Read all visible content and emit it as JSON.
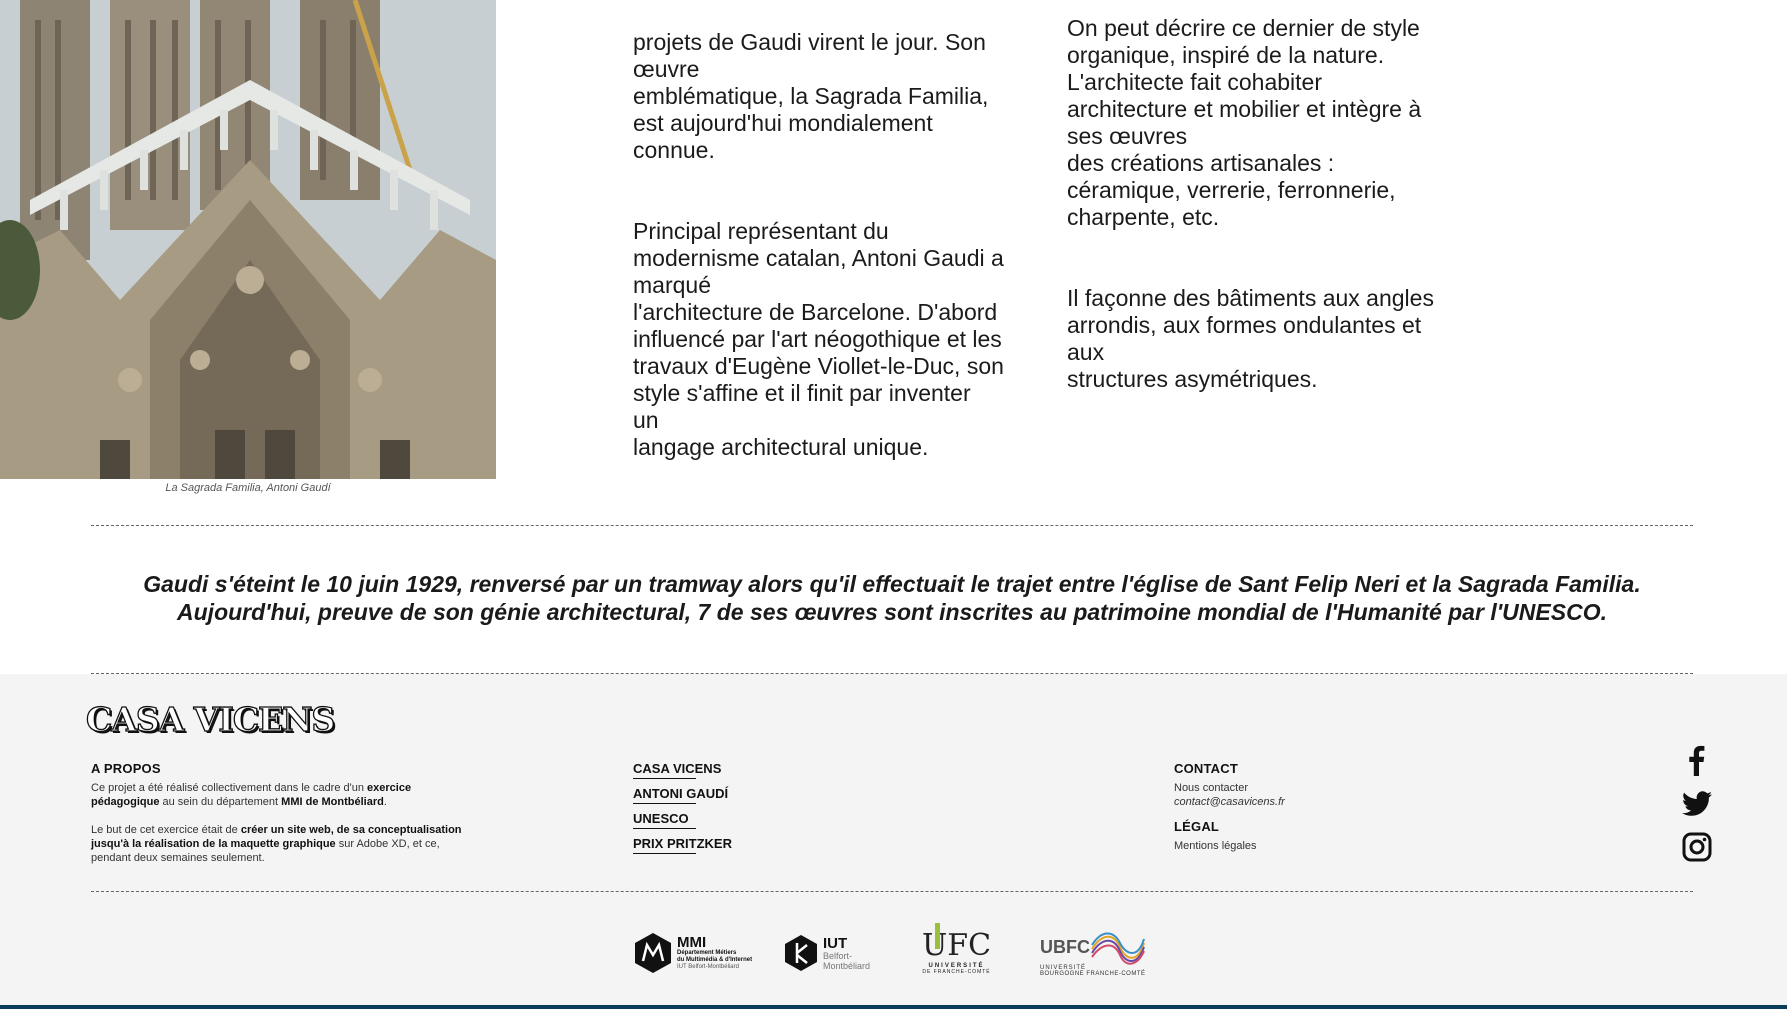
{
  "photo": {
    "alt": "La Sagrada Familia, Antoni Gaudí",
    "caption": "La Sagrada Familia, Antoni Gaudí"
  },
  "column1": {
    "p1": "projets de Gaudi virent le jour. Son\nœuvre\nemblématique, la Sagrada Familia,\nest aujourd'hui mondialement\nconnue.",
    "p2": "Principal représentant du\nmodernisme catalan, Antoni Gaudi a\nmarqué\nl'architecture de Barcelone. D'abord\ninfluencé par l'art néogothique et les\ntravaux d'Eugène Viollet-le-Duc, son\nstyle s'affine et il finit par inventer\nun\nlangage architectural unique."
  },
  "column2": {
    "p1": "On peut décrire ce dernier de style\norganique, inspiré de la nature.\nL'architecte fait cohabiter\narchitecture et mobilier et intègre à\nses œuvres\ndes créations artisanales :\ncéramique, verrerie, ferronnerie,\ncharpente, etc.",
    "p2": "Il façonne des bâtiments aux angles\narrondis, aux formes ondulantes et\naux\nstructures asymétriques."
  },
  "quote": {
    "line1": "Gaudi s'éteint le 10 juin 1929, renversé par un tramway alors qu'il effectuait le trajet entre l'église de Sant Felip Neri et la Sagrada Familia.",
    "line2": "Aujourd'hui, preuve de son génie architectural, 7 de ses œuvres sont inscrites au patrimoine mondial de l'Humanité par l'UNESCO."
  },
  "footer": {
    "logo": "CASA VICENS",
    "about": {
      "heading": "A PROPOS",
      "p1_a": "Ce projet a été réalisé collectivement dans le cadre d'un ",
      "p1_b": "exercice pédagogique",
      "p1_c": " au sein du département ",
      "p1_d": "MMI de Montbéliard",
      "p1_e": ".",
      "p2_a": "Le but de cet exercice était de ",
      "p2_b": "créer un site web, de sa conceptualisation jusqu'à la réalisation de la maquette graphique",
      "p2_c": " sur Adobe XD, et ce, pendant deux semaines seulement."
    },
    "nav": [
      "CASA VICENS",
      "ANTONI GAUDÍ",
      "UNESCO",
      "PRIX PRITZKER"
    ],
    "contact": {
      "heading": "CONTACT",
      "label": "Nous contacter",
      "email": "contact@casavicens.fr"
    },
    "legal": {
      "heading": "LÉGAL",
      "link": "Mentions légales"
    },
    "social": [
      "facebook-icon",
      "twitter-icon",
      "instagram-icon"
    ],
    "partners": {
      "mmi": {
        "title": "MMI",
        "sub1": "Département Métiers",
        "sub2": "du Multimédia & d'Internet",
        "sub3": "IUT Belfort-Montbéliard"
      },
      "iut": {
        "title": "IUT",
        "sub1": "Belfort-",
        "sub2": "Montbéliard"
      },
      "ufc": {
        "title": "UFC",
        "sub1": "UNIVERSITÉ",
        "sub2": "DE FRANCHE-COMTÉ"
      },
      "ubfc": {
        "title": "UBFC",
        "sub1": "UNIVERSITÉ",
        "sub2": "BOURGOGNE FRANCHE-COMTÉ"
      }
    }
  }
}
